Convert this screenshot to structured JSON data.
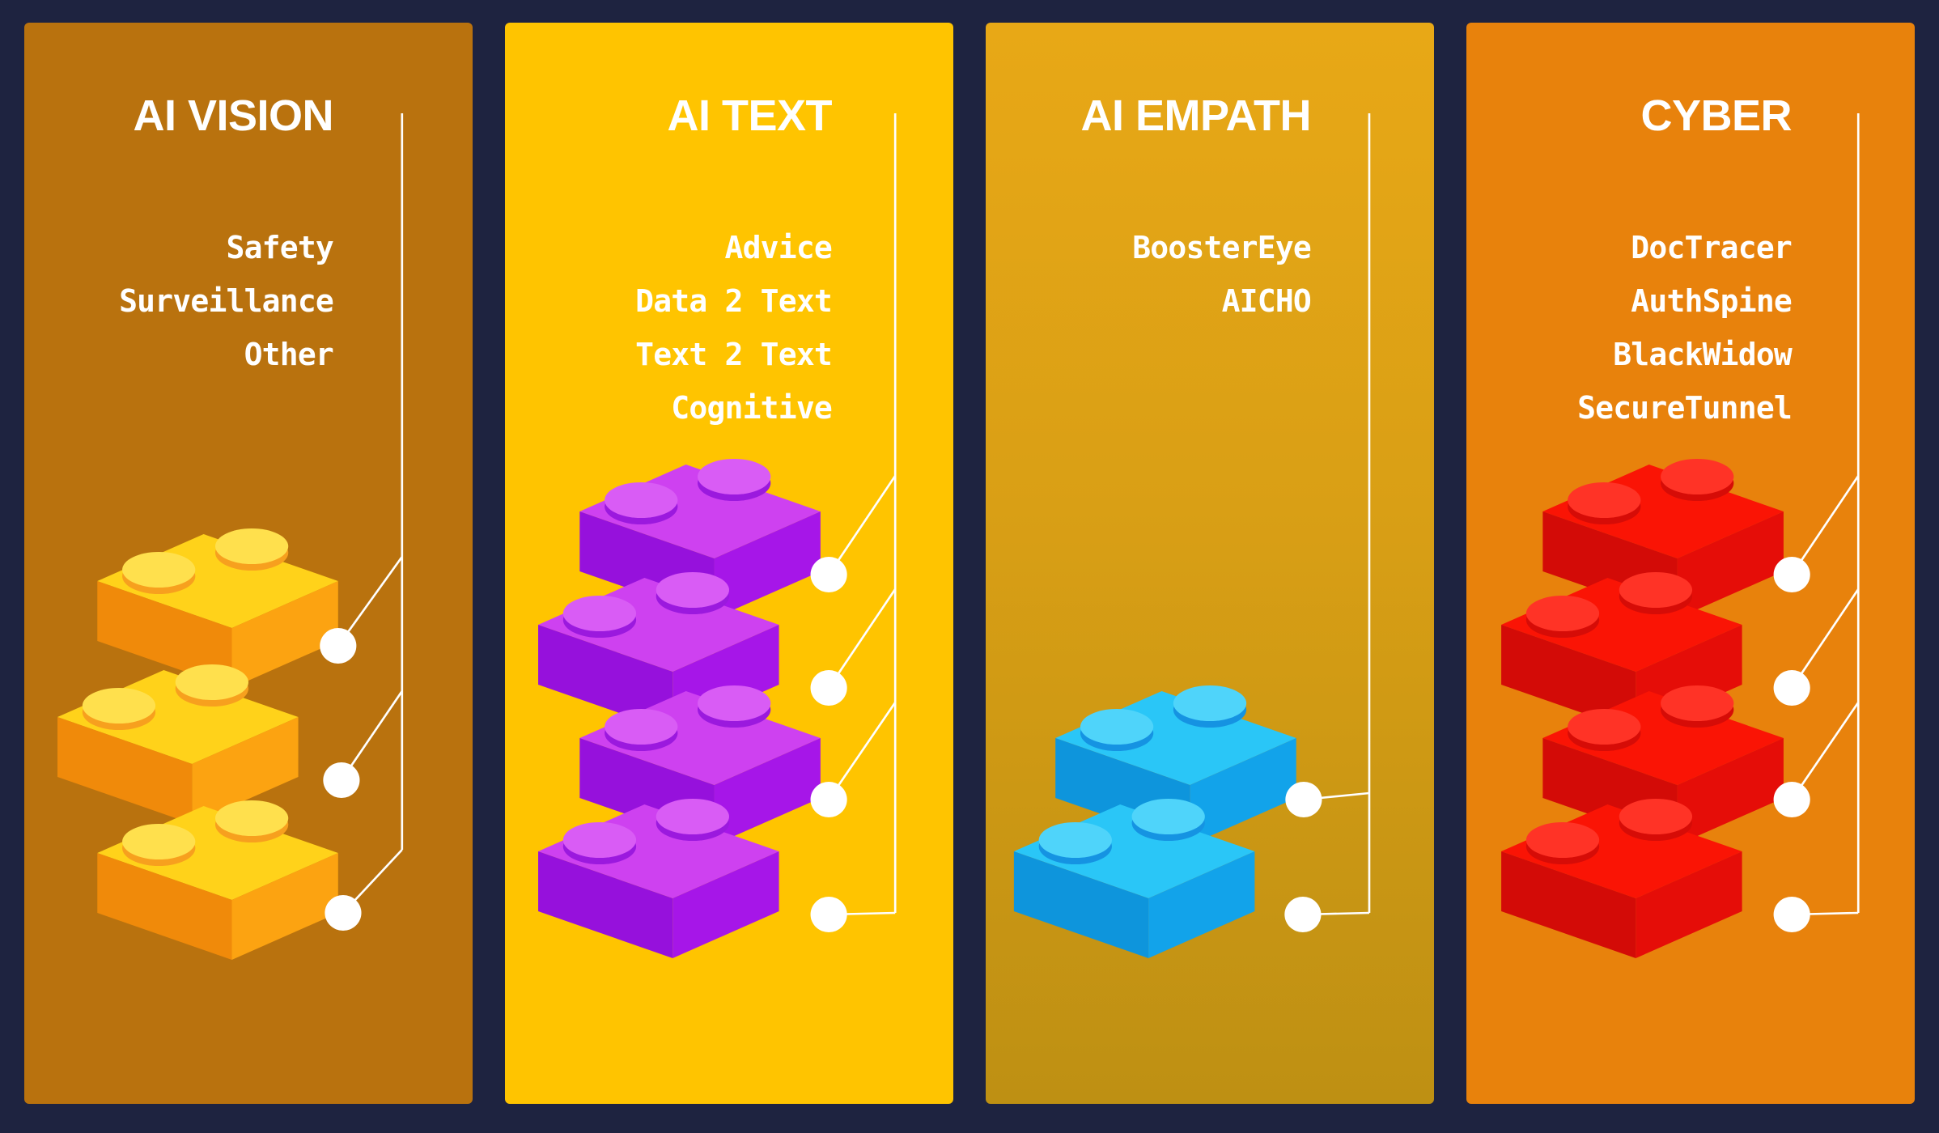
{
  "background_color": "#1E2340",
  "layout": {
    "columns": 4,
    "style": "isometric-lego-brick-stack-infographic"
  },
  "panels": [
    {
      "id": "ai-vision",
      "title": "AI VISION",
      "panel_color": "#B9720E",
      "brick_colors": {
        "top": "#FFD21A",
        "right": "#FCA311",
        "left": "#F08A0A",
        "stud": "#FFE04D",
        "stud_shadow": "#F7A01E"
      },
      "brick_count": 3,
      "items": [
        "Safety",
        "Surveillance",
        "Other"
      ]
    },
    {
      "id": "ai-text",
      "title": "AI TEXT",
      "panel_color": "#FFC400",
      "brick_colors": {
        "top": "#CE41F0",
        "right": "#A616E8",
        "left": "#9611DC",
        "stud": "#D95CF5",
        "stud_shadow": "#9B19DE"
      },
      "brick_count": 4,
      "items": [
        "Advice",
        "Data 2 Text",
        "Text 2 Text",
        "Cognitive"
      ]
    },
    {
      "id": "ai-empath",
      "title": "AI EMPATH",
      "panel_color": "#E8A816",
      "panel_color_bottom": "#BE9013",
      "brick_colors": {
        "top": "#2AC6F7",
        "right": "#12A3EA",
        "left": "#0E95DC",
        "stud": "#4FD4FA",
        "stud_shadow": "#1593E2"
      },
      "brick_count": 2,
      "items": [
        "BoosterEye",
        "AICHO"
      ]
    },
    {
      "id": "cyber",
      "title": "CYBER",
      "panel_color": "#E8820C",
      "brick_colors": {
        "top": "#FA1405",
        "right": "#E50D08",
        "left": "#D30B07",
        "stud": "#FF3326",
        "stud_shadow": "#D60C07"
      },
      "brick_count": 4,
      "items": [
        "DocTracer",
        "AuthSpine",
        "BlackWidow",
        "SecureTunnel"
      ]
    }
  ],
  "connector": {
    "dot_color": "#FFFFFF",
    "line_color": "#FFFFFF"
  }
}
